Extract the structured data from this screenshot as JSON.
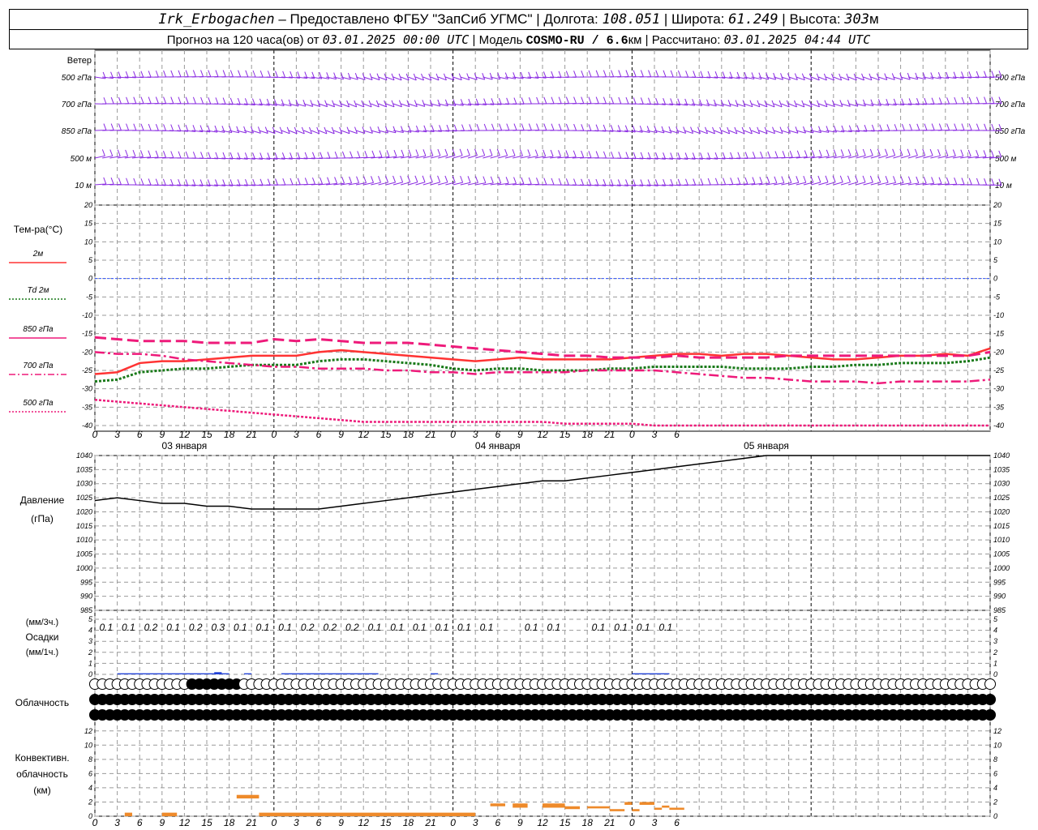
{
  "header": {
    "station": "Irk_Erbogachen",
    "provider": "– Предоставлено ФГБУ \"ЗапСиб УГМС\"",
    "lon_label": "Долгота:",
    "lon": "108.051",
    "lat_label": "Широта:",
    "lat": "61.249",
    "alt_label": "Высота:",
    "alt": "303",
    "alt_unit": "м",
    "forecast_text": "Прогноз на 120 часа(ов) от",
    "forecast_from": "03.01.2025 00:00 UTC",
    "model_label": "Модель",
    "model": "COSMO-RU / 6.6",
    "model_unit": "км",
    "calc_label": "Рассчитано:",
    "calc_time": "03.01.2025 04:44 UTC"
  },
  "wind_panel": {
    "title": "Ветер",
    "levels": [
      "500 гПа",
      "700 гПа",
      "850 гПа",
      "500 м",
      "10  м"
    ]
  },
  "temp_panel": {
    "title": "Тем-ра(°C)",
    "legend": [
      {
        "label": "2м",
        "color": "#ff3333",
        "style": "solid"
      },
      {
        "label": "Td  2м",
        "color": "#1a7a1a",
        "style": "dotted"
      },
      {
        "label": "850 гПа",
        "color": "#ee1a7a",
        "style": "solid"
      },
      {
        "label": "700 гПа",
        "color": "#ee1a7a",
        "style": "dashdot"
      },
      {
        "label": "500 гПа",
        "color": "#ee1a7a",
        "style": "dotted"
      }
    ]
  },
  "pressure_panel": {
    "title": "Давление",
    "unit": "(гПа)"
  },
  "precip_panel": {
    "unit_top": "(мм/3ч.)",
    "title": "Осадки",
    "unit_bottom": "(мм/1ч.)"
  },
  "cloud_panel": {
    "title": "Облачность"
  },
  "conv_panel": {
    "title_1": "Конвективн.",
    "title_2": "облачность",
    "unit": "(км)"
  },
  "dates": [
    "03 января",
    "04 января",
    "05 января"
  ],
  "chart_data": {
    "type": "line",
    "x_hours": [
      0,
      3,
      6,
      9,
      12,
      15,
      18,
      21,
      24,
      27,
      30,
      33,
      36,
      39,
      42,
      45,
      48,
      51,
      54,
      57,
      60,
      63,
      66,
      69,
      72,
      75,
      78,
      81,
      84,
      87,
      90,
      93,
      96,
      99,
      102,
      105,
      108,
      111,
      114,
      117,
      120
    ],
    "x_tick_labels": [
      "0",
      "3",
      "6",
      "9",
      "12",
      "15",
      "18",
      "21",
      "0",
      "3",
      "6",
      "9",
      "12",
      "15",
      "18",
      "21",
      "0",
      "3",
      "6",
      "9",
      "12",
      "15",
      "18",
      "21",
      "0",
      "3",
      "6"
    ],
    "temperature": {
      "ylim": [
        -40,
        20
      ],
      "yticks": [
        20,
        15,
        10,
        5,
        0,
        -5,
        -10,
        -15,
        -20,
        -25,
        -30,
        -35,
        -40
      ],
      "series": [
        {
          "name": "2м",
          "values": [
            -26,
            -25.5,
            -23,
            -22.5,
            -22.5,
            -22,
            -21.5,
            -21,
            -21,
            -21,
            -20,
            -19.5,
            -20,
            -20.5,
            -21,
            -21.5,
            -22,
            -22.5,
            -22,
            -21.5,
            -22,
            -22,
            -22,
            -22,
            -21.5,
            -21,
            -20.5,
            -20.5,
            -21,
            -20.5,
            -20.5,
            -21,
            -21.5,
            -22,
            -22,
            -21.5,
            -21,
            -21,
            -20.5,
            -21,
            -19
          ]
        },
        {
          "name": "Td 2м",
          "values": [
            -28,
            -27.5,
            -25.5,
            -25,
            -24.5,
            -24.5,
            -24,
            -23.5,
            -23.5,
            -23.5,
            -22.5,
            -22,
            -22,
            -22.5,
            -23,
            -23.5,
            -24.5,
            -25,
            -24.5,
            -24.5,
            -25,
            -25,
            -25,
            -24.5,
            -24.5,
            -24,
            -24,
            -24,
            -24,
            -24.5,
            -24.5,
            -24.5,
            -24,
            -24,
            -23.5,
            -23.5,
            -23,
            -23,
            -23,
            -22.5,
            -21.5
          ]
        },
        {
          "name": "850 гПа",
          "values": [
            -16,
            -16.5,
            -17,
            -17,
            -17,
            -17.5,
            -17.5,
            -17.5,
            -16.5,
            -17,
            -16.5,
            -17,
            -17.5,
            -17.5,
            -17.5,
            -18,
            -18.5,
            -19,
            -19.5,
            -20,
            -20.5,
            -21,
            -21,
            -21.5,
            -21.5,
            -21.5,
            -21,
            -21.5,
            -21.5,
            -21.5,
            -21.5,
            -21,
            -21,
            -21,
            -21,
            -21,
            -21,
            -21,
            -21,
            -21,
            -20
          ]
        },
        {
          "name": "700 гПа",
          "values": [
            -20,
            -20.5,
            -20.5,
            -21,
            -22,
            -22.5,
            -23,
            -23.5,
            -24,
            -24,
            -24.5,
            -24.5,
            -24.5,
            -25,
            -25,
            -25.5,
            -25.5,
            -26,
            -25.5,
            -25.5,
            -25.5,
            -25.5,
            -25,
            -25,
            -25,
            -25,
            -25.5,
            -26,
            -26.5,
            -27,
            -27,
            -27.5,
            -28,
            -28,
            -28,
            -28.5,
            -28,
            -28,
            -28,
            -28,
            -27.5
          ]
        },
        {
          "name": "500 гПа",
          "values": [
            -33,
            -33.5,
            -34,
            -34.5,
            -35,
            -35.5,
            -36,
            -36.5,
            -37,
            -37.5,
            -38,
            -38.5,
            -39,
            -39,
            -39,
            -39,
            -39,
            -39,
            -39,
            -39,
            -39,
            -39.5,
            -39.5,
            -39.5,
            -39.5,
            -40,
            -40,
            -40,
            -40,
            -40,
            -40,
            -40,
            -40,
            -40,
            -40,
            -40,
            -40,
            -40,
            -40,
            -40,
            -40
          ]
        }
      ]
    },
    "pressure": {
      "ylim": [
        985,
        1040
      ],
      "yticks": [
        1040,
        1035,
        1030,
        1025,
        1020,
        1015,
        1010,
        1005,
        1000,
        995,
        990,
        985
      ],
      "values": [
        1024,
        1025,
        1024,
        1023,
        1023,
        1022,
        1022,
        1021,
        1021,
        1021,
        1021,
        1022,
        1023,
        1024,
        1025,
        1026,
        1027,
        1028,
        1029,
        1030,
        1031,
        1031,
        1032,
        1033,
        1034,
        1035,
        1036,
        1037,
        1038,
        1039,
        1040,
        1040,
        1040,
        1040,
        1040,
        1040,
        1040,
        1040,
        1040,
        1040,
        1040
      ]
    },
    "precip_3h": {
      "ylim": [
        0,
        5
      ],
      "yticks": [
        5,
        4,
        3,
        2,
        1,
        0
      ],
      "labels": [
        {
          "h": 1.5,
          "v": "0.1"
        },
        {
          "h": 4.5,
          "v": "0.1"
        },
        {
          "h": 7.5,
          "v": "0.2"
        },
        {
          "h": 10.5,
          "v": "0.1"
        },
        {
          "h": 13.5,
          "v": "0.2"
        },
        {
          "h": 16.5,
          "v": "0.3"
        },
        {
          "h": 19.5,
          "v": "0.1"
        },
        {
          "h": 22.5,
          "v": "0.1"
        },
        {
          "h": 25.5,
          "v": "0.1"
        },
        {
          "h": 28.5,
          "v": "0.2"
        },
        {
          "h": 31.5,
          "v": "0.2"
        },
        {
          "h": 34.5,
          "v": "0.2"
        },
        {
          "h": 37.5,
          "v": "0.1"
        },
        {
          "h": 40.5,
          "v": "0.1"
        },
        {
          "h": 43.5,
          "v": "0.1"
        },
        {
          "h": 46.5,
          "v": "0.1"
        },
        {
          "h": 49.5,
          "v": "0.1"
        },
        {
          "h": 52.5,
          "v": "0.1"
        },
        {
          "h": 58.5,
          "v": "0.1"
        },
        {
          "h": 61.5,
          "v": "0.1"
        },
        {
          "h": 67.5,
          "v": "0.1"
        },
        {
          "h": 70.5,
          "v": "0.1"
        },
        {
          "h": 73.5,
          "v": "0.1"
        },
        {
          "h": 76.5,
          "v": "0.1"
        }
      ],
      "bars_1h": [
        {
          "from": 3,
          "to": 18,
          "v": 0.1
        },
        {
          "from": 16,
          "to": 17,
          "v": 0.2
        },
        {
          "from": 20,
          "to": 21,
          "v": 0.1
        },
        {
          "from": 25,
          "to": 38,
          "v": 0.1
        },
        {
          "from": 45,
          "to": 46,
          "v": 0.1
        },
        {
          "from": 72,
          "to": 77,
          "v": 0.1
        }
      ]
    },
    "convective_cloud_km": {
      "ylim": [
        0,
        13
      ],
      "yticks": [
        12,
        10,
        8,
        6,
        4,
        2,
        0
      ],
      "segments": [
        {
          "from": 4,
          "to": 5,
          "top": 0.5,
          "base": 0
        },
        {
          "from": 9,
          "to": 11,
          "top": 0.5,
          "base": 0
        },
        {
          "from": 19,
          "to": 22,
          "top": 3,
          "base": 2.5
        },
        {
          "from": 22,
          "to": 51,
          "top": 0.5,
          "base": 0
        },
        {
          "from": 53,
          "to": 55,
          "top": 1.8,
          "base": 1.4
        },
        {
          "from": 56,
          "to": 58,
          "top": 1.8,
          "base": 1.2
        },
        {
          "from": 60,
          "to": 63,
          "top": 1.8,
          "base": 1.2
        },
        {
          "from": 63,
          "to": 65,
          "top": 1.4,
          "base": 1.0
        },
        {
          "from": 66,
          "to": 69,
          "top": 1.4,
          "base": 1.1
        },
        {
          "from": 69,
          "to": 71,
          "top": 1.0,
          "base": 0.7
        },
        {
          "from": 71,
          "to": 72,
          "top": 2.0,
          "base": 1.6
        },
        {
          "from": 72,
          "to": 73,
          "top": 1.0,
          "base": 0.7
        },
        {
          "from": 73,
          "to": 75,
          "top": 2.0,
          "base": 1.6
        },
        {
          "from": 75,
          "to": 76,
          "top": 1.2,
          "base": 0.9
        },
        {
          "from": 76,
          "to": 77,
          "top": 1.5,
          "base": 1.2
        },
        {
          "from": 77,
          "to": 79,
          "top": 1.2,
          "base": 0.9
        }
      ]
    },
    "colors": {
      "t2m": "#ff3333",
      "td": "#1a7a1a",
      "upper": "#ee1a7a",
      "wind": "#8a2be2",
      "precip": "#1f3fd6",
      "conv": "#ee8a2a",
      "zero": "#3355ff"
    }
  }
}
